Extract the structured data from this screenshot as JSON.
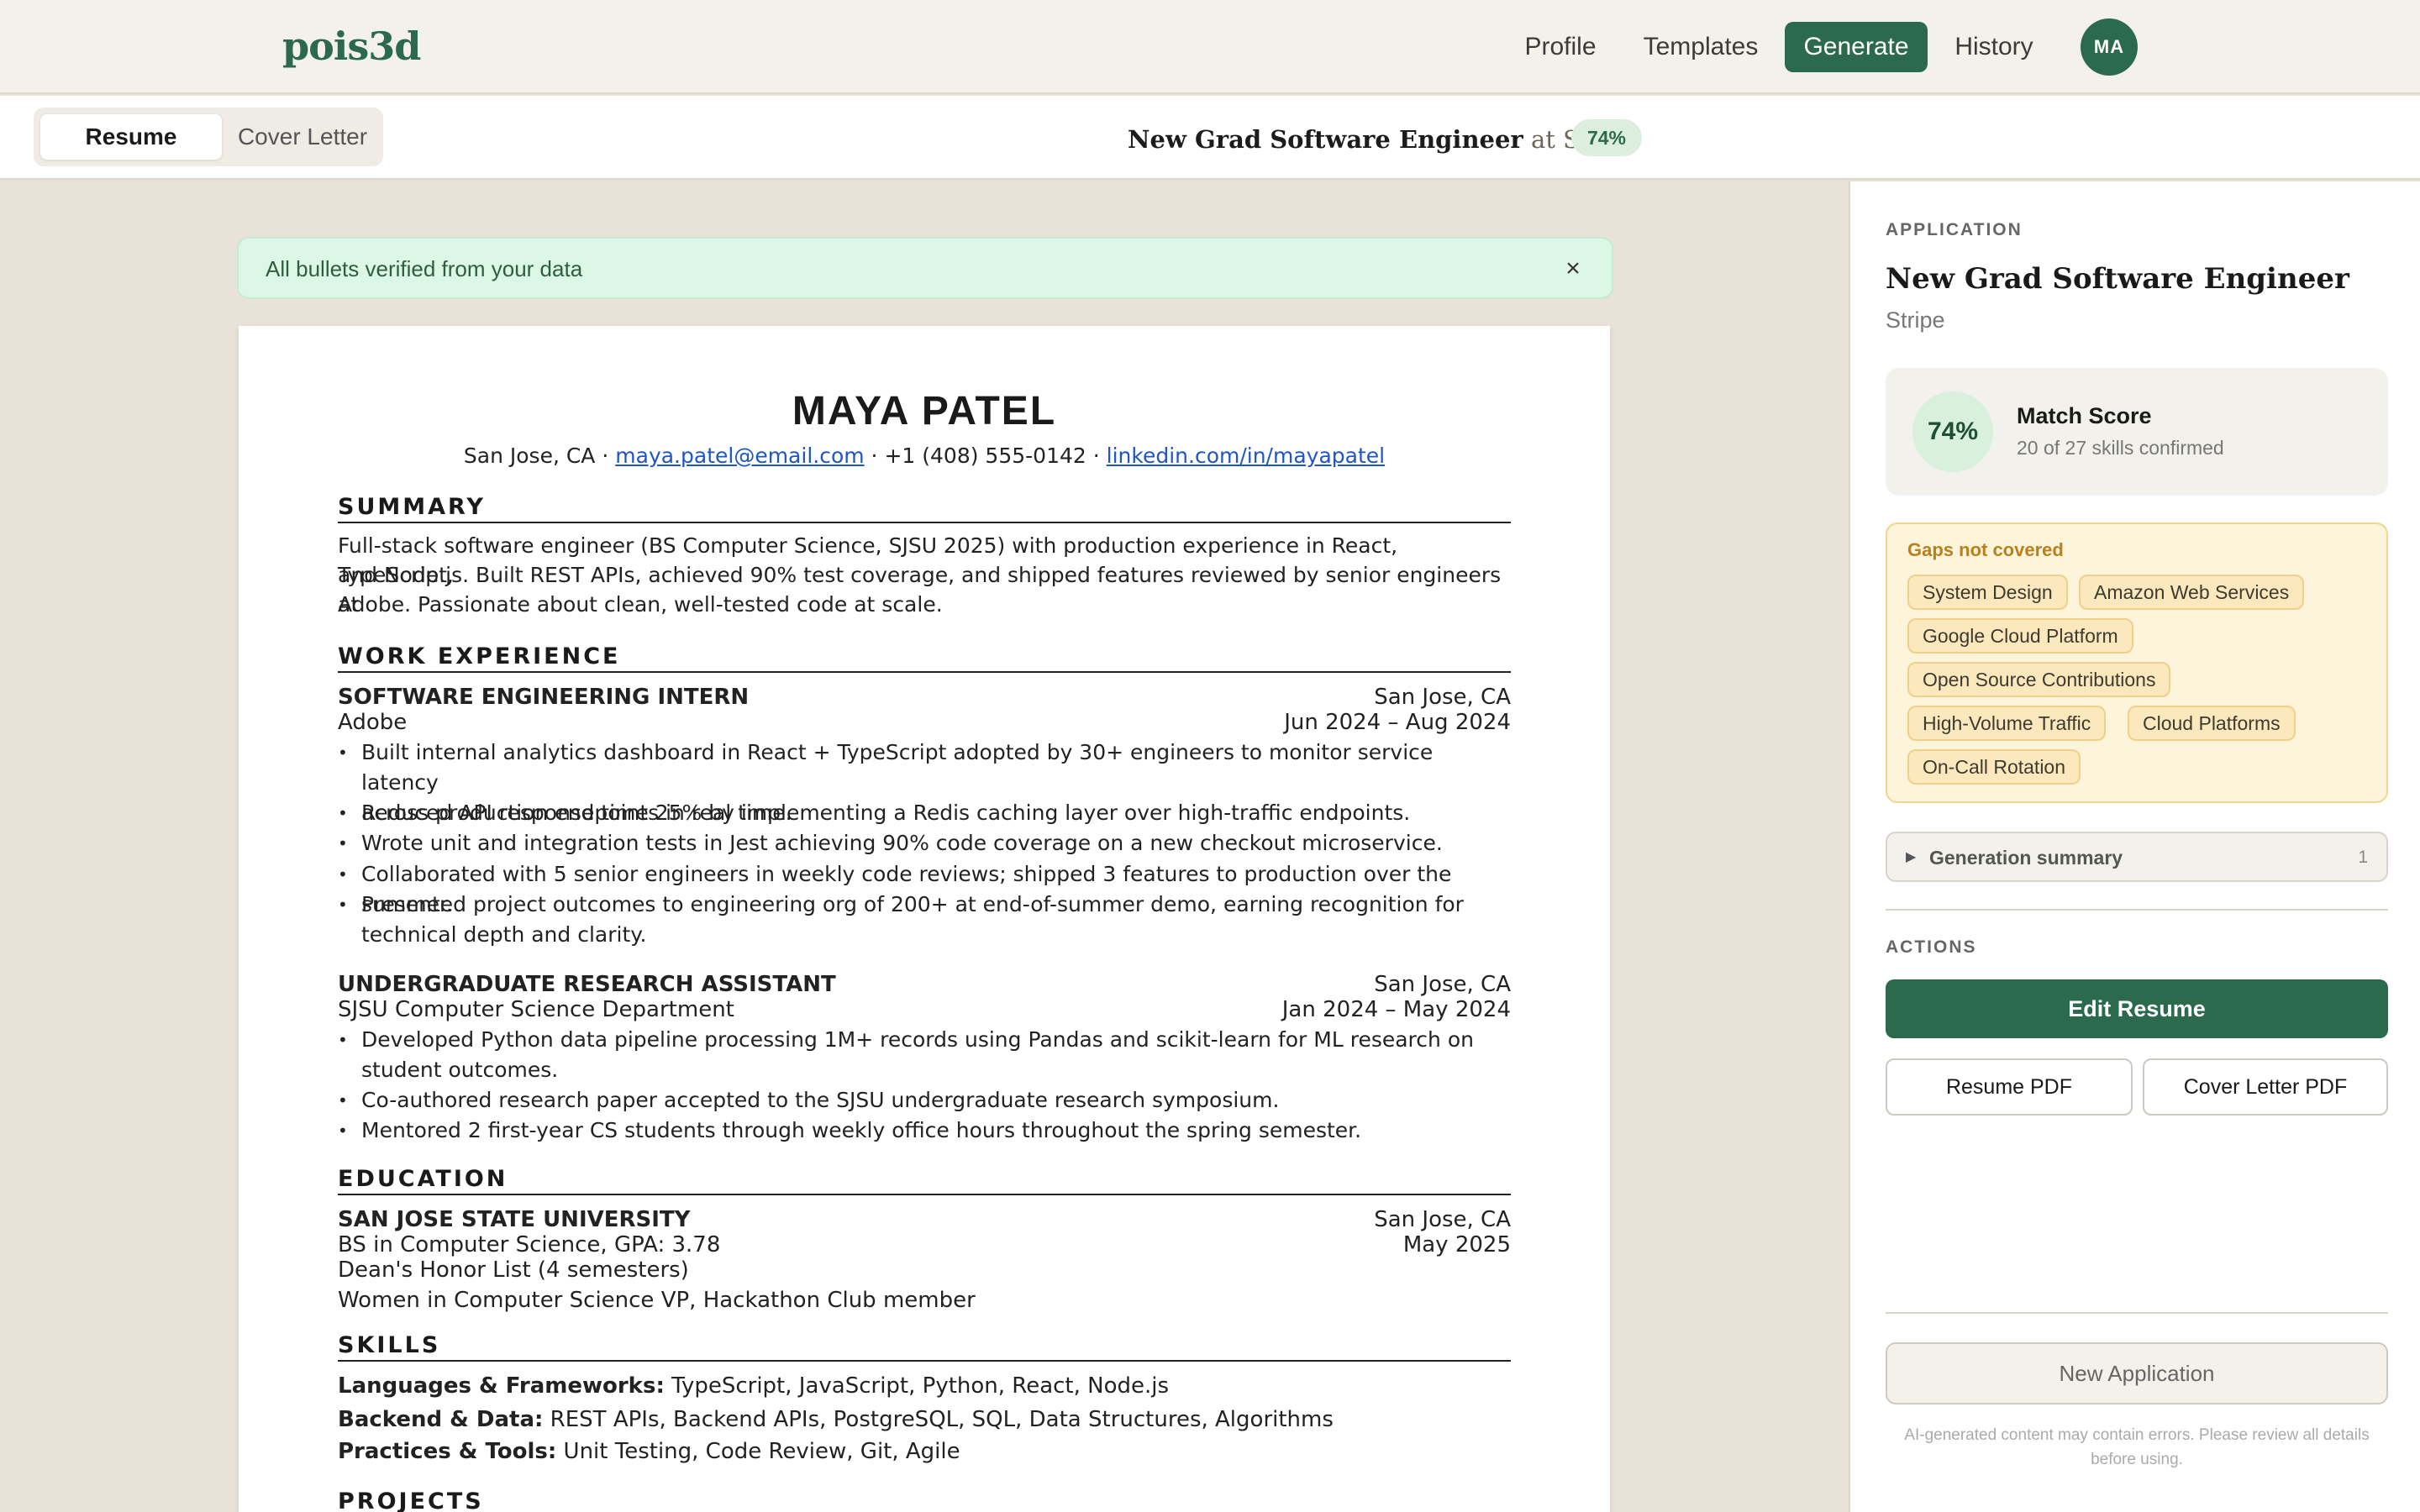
{
  "nav": {
    "logo": "pois3d",
    "links": [
      "Profile",
      "Templates",
      "Generate",
      "History"
    ],
    "active": "Generate",
    "avatar_initials": "MA"
  },
  "tabs": {
    "resume": "Resume",
    "cover_letter": "Cover Letter"
  },
  "job": {
    "title": "New Grad Software Engineer",
    "at_company": "at Stripe",
    "match_badge": "74%"
  },
  "banner": {
    "text": "All bullets verified from your data",
    "close_icon": "×"
  },
  "resume": {
    "name": "MAYA PATEL",
    "location": "San Jose, CA",
    "email": "maya.patel@email.com",
    "phone": "+1 (408) 555-0142",
    "linkedin": "linkedin.com/in/mayapatel",
    "sections": {
      "summary": "SUMMARY",
      "work": "WORK EXPERIENCE",
      "education": "EDUCATION",
      "skills": "SKILLS",
      "projects": "PROJECTS"
    },
    "summary_lines": [
      "Full-stack software engineer (BS Computer Science, SJSU 2025) with production experience in React, TypeScript,",
      "and Node.js. Built REST APIs, achieved 90% test coverage, and shipped features reviewed by senior engineers at",
      "Adobe. Passionate about clean, well-tested code at scale."
    ],
    "jobs": [
      {
        "role": "SOFTWARE ENGINEERING INTERN",
        "location": "San Jose, CA",
        "org": "Adobe",
        "dates": "Jun 2024 – Aug 2024",
        "bullets": [
          [
            "Built internal analytics dashboard in React + TypeScript adopted by 30+ engineers to monitor service latency",
            "across production endpoints in real time."
          ],
          [
            "Reduced API response time 25% by implementing a Redis caching layer over high-traffic endpoints."
          ],
          [
            "Wrote unit and integration tests in Jest achieving 90% code coverage on a new checkout microservice."
          ],
          [
            "Collaborated with 5 senior engineers in weekly code reviews; shipped 3 features to production over the summer."
          ],
          [
            "Presented project outcomes to engineering org of 200+ at end-of-summer demo, earning recognition for",
            "technical depth and clarity."
          ]
        ]
      },
      {
        "role": "UNDERGRADUATE RESEARCH ASSISTANT",
        "location": "San Jose, CA",
        "org": "SJSU Computer Science Department",
        "dates": "Jan 2024 – May 2024",
        "bullets": [
          [
            "Developed Python data pipeline processing 1M+ records using Pandas and scikit-learn for ML research on",
            "student outcomes."
          ],
          [
            "Co-authored research paper accepted to the SJSU undergraduate research symposium."
          ],
          [
            "Mentored 2 first-year CS students through weekly office hours throughout the spring semester."
          ]
        ]
      }
    ],
    "education": {
      "school": "SAN JOSE STATE UNIVERSITY",
      "location": "San Jose, CA",
      "degree": "BS in Computer Science, GPA: 3.78",
      "date": "May 2025",
      "honors": "Dean's Honor List (4 semesters)",
      "activities": "Women in Computer Science VP, Hackathon Club member"
    },
    "skills": [
      {
        "label": "Languages & Frameworks:",
        "value": " TypeScript, JavaScript, Python, React, Node.js"
      },
      {
        "label": "Backend & Data:",
        "value": " REST APIs, Backend APIs, PostgreSQL, SQL, Data Structures, Algorithms"
      },
      {
        "label": "Practices & Tools:",
        "value": " Unit Testing, Code Review, Git, Agile"
      }
    ]
  },
  "side": {
    "application_label": "APPLICATION",
    "title": "New Grad Software Engineer",
    "company": "Stripe",
    "score": "74%",
    "score_title": "Match Score",
    "score_sub": "20 of 27 skills confirmed",
    "gaps_title": "Gaps not covered",
    "gaps": [
      "System Design",
      "Amazon Web Services",
      "Google Cloud Platform",
      "Open Source Contributions",
      "High-Volume Traffic",
      "Cloud Platforms",
      "On-Call Rotation"
    ],
    "gen_summary": "Generation summary",
    "gen_count": "1",
    "actions_label": "ACTIONS",
    "edit_resume": "Edit Resume",
    "resume_pdf": "Resume PDF",
    "cover_pdf": "Cover Letter PDF",
    "new_application": "New Application",
    "disclaimer": "AI-generated content may contain errors. Please review all details before using."
  }
}
